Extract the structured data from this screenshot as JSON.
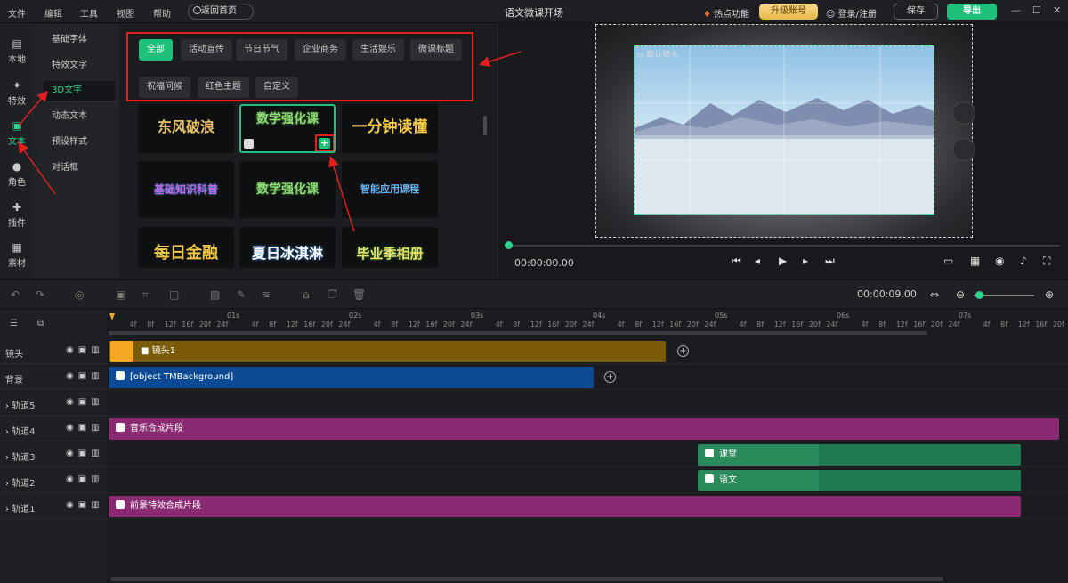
{
  "menu": {
    "file": "文件",
    "edit": "编辑",
    "tools": "工具",
    "view": "视图",
    "help": "帮助",
    "home_button": "返回首页"
  },
  "app_title": "语文微课开场",
  "header": {
    "hot_label": "热点功能",
    "upgrade_label": "升级账号",
    "user_label": "登录/注册",
    "save_label": "保存",
    "export_label": "导出"
  },
  "left_nav": [
    {
      "label": "本地",
      "icon": "folder-icon"
    },
    {
      "label": "特效",
      "icon": "effects-icon"
    },
    {
      "label": "文本",
      "icon": "text-icon"
    },
    {
      "label": "角色",
      "icon": "person-icon"
    },
    {
      "label": "插件",
      "icon": "plugin-icon"
    },
    {
      "label": "素材",
      "icon": "material-icon"
    }
  ],
  "categories": [
    "基础字体",
    "特效文字",
    "3D文字",
    "动态文本",
    "预设样式",
    "对话框"
  ],
  "filters": [
    "全部",
    "活动宣传",
    "节日节气",
    "企业商务",
    "生活娱乐",
    "微课标题",
    "祝福问候",
    "红色主题",
    "自定义"
  ],
  "templates": [
    "东风破浪",
    "数学强化课",
    "一分钟读懂",
    "基础知识科普",
    "数学强化课",
    "智能应用课程",
    "每日金融",
    "夏日冰淇淋",
    "毕业季相册"
  ],
  "preview": {
    "camera_label": "默认镜头",
    "time_current": "00:00:00.00",
    "play_icon": "play-icon"
  },
  "timeline": {
    "time_total": "00:00:09.00",
    "seconds": [
      "01s",
      "02s",
      "03s",
      "04s",
      "05s",
      "06s",
      "07s"
    ],
    "frame_ticks": [
      "4f",
      "8f",
      "12f",
      "16f",
      "20f",
      "24f"
    ],
    "tracks": [
      {
        "name": "镜头",
        "clip": "镜头1",
        "color": "#7a5c08"
      },
      {
        "name": "背景",
        "clip": "[object TMBackground]",
        "color": "#0c4a96"
      },
      {
        "name": "轨道5",
        "clip": ""
      },
      {
        "name": "轨道4",
        "clip": "音乐合成片段",
        "color": "#8a2a72"
      },
      {
        "name": "轨道3",
        "clip": "课堂",
        "color": "#1f7a4f"
      },
      {
        "name": "轨道2",
        "clip": "语文",
        "color": "#1f7a4f"
      },
      {
        "name": "轨道1",
        "clip": "前景特效合成片段",
        "color": "#8a2a72"
      }
    ]
  },
  "colors": {
    "accent": "#1ec07a",
    "annotation": "#e02020",
    "upgrade": "#f0c860"
  }
}
